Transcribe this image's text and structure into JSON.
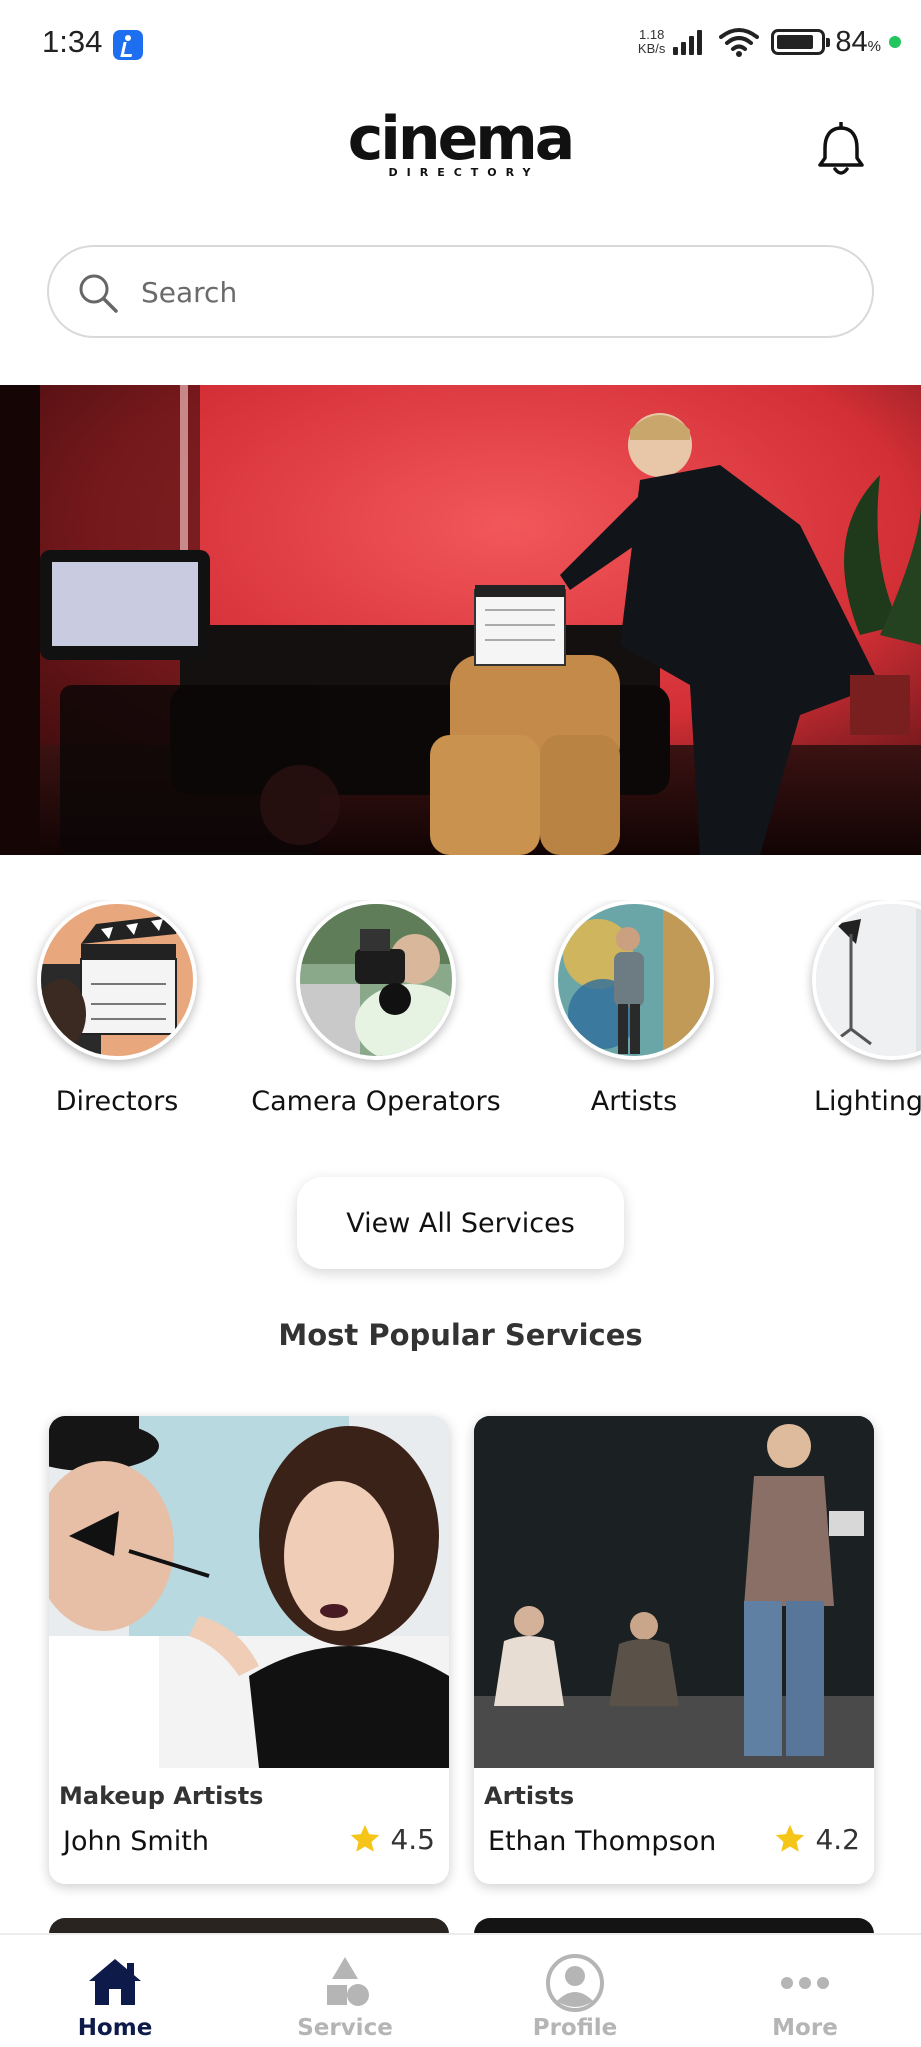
{
  "status_bar": {
    "time": "1:34",
    "net_speed_value": "1.18",
    "net_speed_unit": "KB/s",
    "battery_pct": "84",
    "battery_unit": "%",
    "battery_level": 0.84,
    "signal_bars": 4,
    "colors": {
      "app_icon": "#1e6ff0",
      "dot": "#22c55e"
    }
  },
  "header": {
    "logo_main": "cinema",
    "logo_sub": "DIRECTORY",
    "bell_icon": "bell-icon"
  },
  "search": {
    "placeholder": "Search",
    "value": "",
    "icon": "search-icon"
  },
  "hero": {
    "image": "film-set-clapperboard-photo"
  },
  "categories": [
    {
      "label": "Directors",
      "image": "director-clapperboard-photo"
    },
    {
      "label": "Camera Operators",
      "image": "camera-operator-photo"
    },
    {
      "label": "Artists",
      "image": "artist-mural-photo"
    },
    {
      "label": "Lighting Op",
      "image": "lighting-stand-photo"
    }
  ],
  "view_all_label": "View All Services",
  "popular": {
    "title": "Most Popular Services",
    "cards": [
      {
        "category": "Makeup Artists",
        "name": "John Smith",
        "rating": "4.5",
        "image": "makeup-artist-photo"
      },
      {
        "category": "Artists",
        "name": "Ethan Thompson",
        "rating": "4.2",
        "image": "stage-actor-photo"
      }
    ]
  },
  "bottom_nav": {
    "items": [
      {
        "label": "Home",
        "icon": "home-icon",
        "active": true
      },
      {
        "label": "Service",
        "icon": "service-icon",
        "active": false
      },
      {
        "label": "Profile",
        "icon": "profile-icon",
        "active": false
      },
      {
        "label": "More",
        "icon": "more-icon",
        "active": false
      }
    ],
    "colors": {
      "active": "#0d1a4a",
      "inactive": "#b5b5b5"
    }
  },
  "colors": {
    "star": "#f5c518",
    "text": "#111111",
    "border": "#d9d9d9"
  }
}
